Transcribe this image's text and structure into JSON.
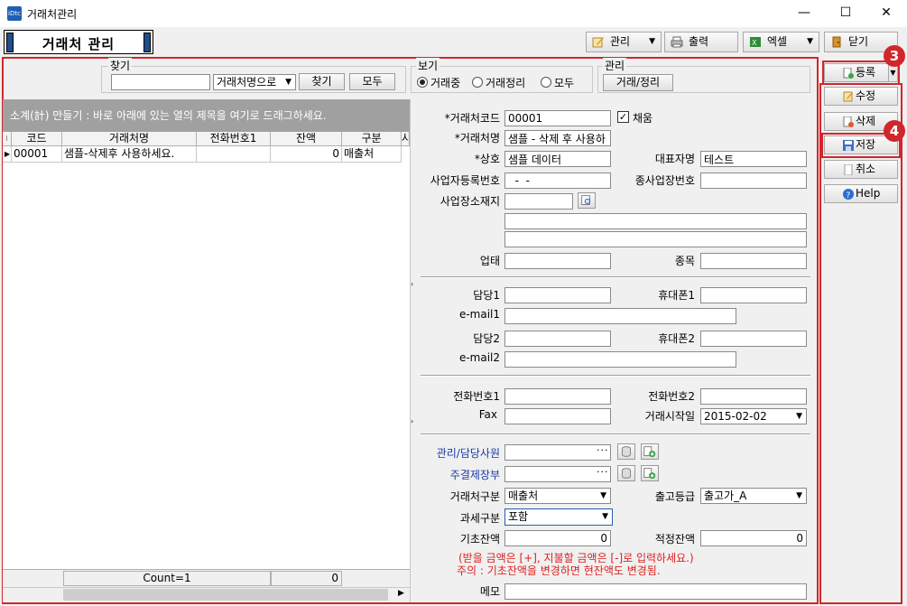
{
  "window": {
    "title": "거래처관리",
    "app_icon_text": "iDtc",
    "minimize_glyph": "—",
    "maximize_glyph": "☐",
    "close_glyph": "✕"
  },
  "header": {
    "title": "거래처 관리",
    "buttons": {
      "manage": "관리",
      "print": "출력",
      "excel": "엑셀",
      "close": "닫기"
    }
  },
  "search": {
    "find_group_label": "찾기",
    "find_value": "",
    "find_mode": "거래처명으로",
    "find_button": "찾기",
    "all_button": "모두",
    "view_group_label": "보기",
    "view_options": [
      "거래중",
      "거래정리",
      "모두"
    ],
    "view_selected": "거래중",
    "manage_group_label": "관리",
    "manage_button": "거래/정리"
  },
  "grid": {
    "group_hint": "소계(計) 만들기 : 바로 아래에 있는 열의 제목을 여기로 드래그하세요.",
    "columns": [
      "코드",
      "거래처명",
      "전화번호1",
      "잔액",
      "구분",
      "사"
    ],
    "rows": [
      {
        "code": "00001",
        "name": "샘플-삭제후 사용하세요.",
        "phone": "",
        "balance": "0",
        "type": "매출처"
      }
    ],
    "footer_count": "Count=1",
    "footer_sum": "0"
  },
  "form": {
    "code_label": "*거래처코드",
    "code_value": "00001",
    "adopt_label": "채움",
    "adopt_checked": true,
    "name_label": "*거래처명",
    "name_value": "샘플 - 삭제 후 사용하",
    "company_label": "*상호",
    "company_value": "샘플 데이터",
    "ceo_label": "대표자명",
    "ceo_value": "테스트",
    "bizno_label": "사업자등록번호",
    "bizno_value": "  -  -",
    "branch_label": "종사업장번호",
    "branch_value": "",
    "address_label": "사업장소재지",
    "biztype_label": "업태",
    "bizitem_label": "종목",
    "contact1_label": "담당1",
    "mobile1_label": "휴대폰1",
    "email1_label": "e-mail1",
    "contact2_label": "담당2",
    "mobile2_label": "휴대폰2",
    "email2_label": "e-mail2",
    "phone1_label": "전화번호1",
    "phone2_label": "전화번호2",
    "fax_label": "Fax",
    "start_label": "거래시작일",
    "start_value": "2015-02-02",
    "staff_label": "관리/담당사원",
    "ledger_label": "주결제장부",
    "ellipsis": "···",
    "category_label": "거래처구분",
    "category_value": "매출처",
    "grade_label": "출고등급",
    "grade_value": "출고가_A",
    "tax_label": "과세구분",
    "tax_value": "포함",
    "opening_label": "기초잔액",
    "opening_value": "0",
    "proper_label": "적정잔액",
    "proper_value": "0",
    "note1": "(받을 금액은 [+], 지불할 금액은 [-]로 입력하세요.)",
    "note2": "주의 : 기초잔액을 변경하면 현잔액도 변경됨.",
    "memo_label": "메모"
  },
  "side": {
    "register": "등록",
    "edit": "수정",
    "delete": "삭제",
    "save": "저장",
    "cancel": "취소",
    "help": "Help"
  },
  "badges": {
    "register": "3",
    "save": "4"
  },
  "colors": {
    "highlight_red": "#d0272d",
    "group_bar": "#a0a0a0",
    "label_blue": "#1a3aa8",
    "note_red": "#e02020"
  }
}
